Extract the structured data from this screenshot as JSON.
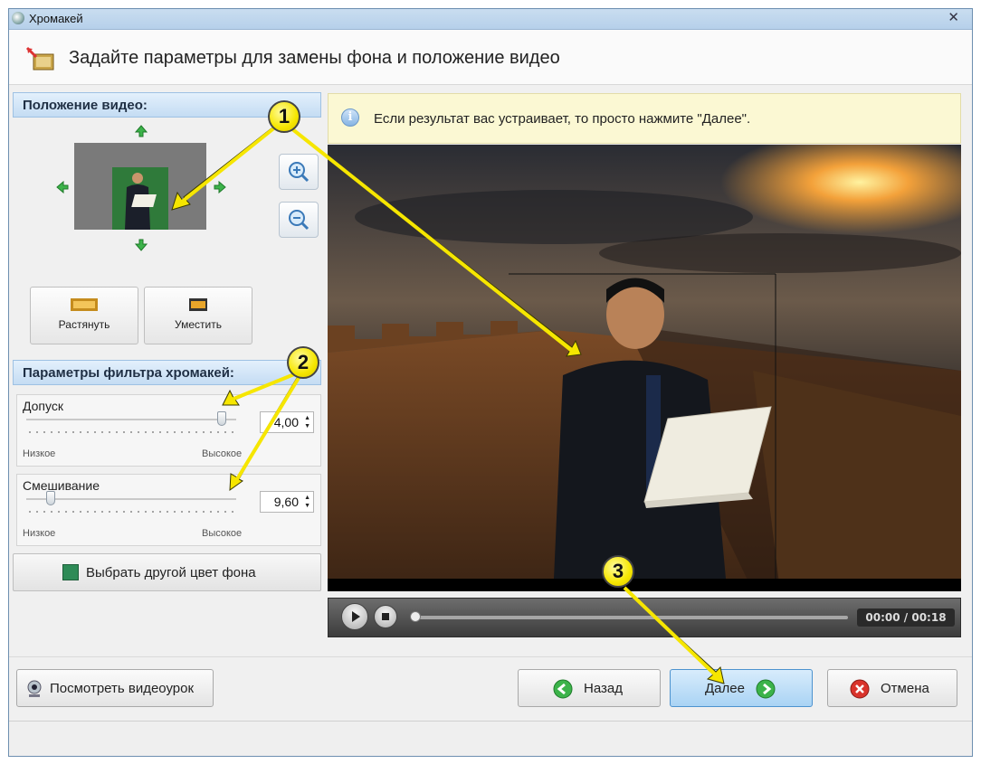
{
  "window": {
    "title": "Хромакей"
  },
  "header": {
    "title": "Задайте параметры для замены фона и положение видео"
  },
  "position_panel": {
    "heading": "Положение видео:",
    "stretch_label": "Растянуть",
    "fit_label": "Уместить"
  },
  "filter_panel": {
    "heading": "Параметры фильтра хромакей:",
    "tolerance": {
      "label": "Допуск",
      "value": "4,00",
      "level": 0.95,
      "low_label": "Низкое",
      "high_label": "Высокое"
    },
    "blend": {
      "label": "Смешивание",
      "value": "9,60",
      "level": 0.1,
      "low_label": "Низкое",
      "high_label": "Высокое"
    },
    "color_button_label": "Выбрать другой цвет фона",
    "key_color": "#2e8b57"
  },
  "info": {
    "text": "Если результат вас устраивает, то просто нажмите \"Далее\"."
  },
  "player": {
    "time": "00:00 / 00:18",
    "progress": 0.0
  },
  "buttons": {
    "tutorial": "Посмотреть видеоурок",
    "back": "Назад",
    "next": "Далее",
    "cancel": "Отмена"
  },
  "callouts": [
    "1",
    "2",
    "3"
  ],
  "colors": {
    "accent": "#a9d3f4",
    "callout": "#f6e600",
    "back_green": "#3cb34a",
    "cancel_red": "#d9332b"
  }
}
